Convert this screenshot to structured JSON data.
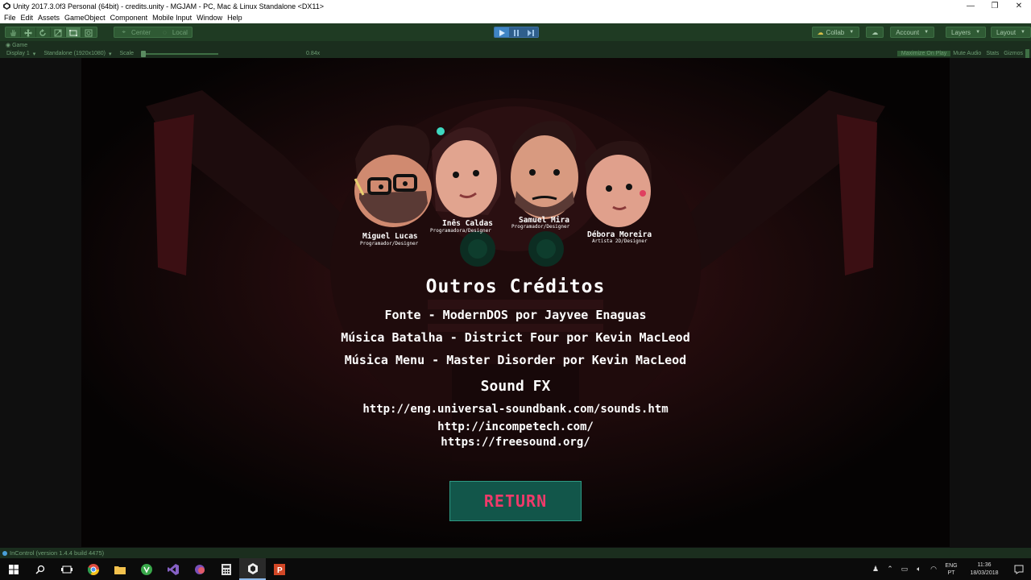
{
  "window": {
    "title": "Unity 2017.3.0f3 Personal (64bit) - credits.unity - MGJAM - PC, Mac & Linux Standalone <DX11>",
    "minimize": "—",
    "maximize": "❐",
    "close": "✕"
  },
  "menu": [
    "File",
    "Edit",
    "Assets",
    "GameObject",
    "Component",
    "Mobile Input",
    "Window",
    "Help"
  ],
  "toolbar": {
    "pivot_center": "Center",
    "pivot_local": "Local",
    "collab": "Collab",
    "account": "Account",
    "layers": "Layers",
    "layout": "Layout"
  },
  "game_view": {
    "tab": "Game",
    "display": "Display 1",
    "resolution": "Standalone (1920x1080)",
    "scale_label": "Scale",
    "scale_value": "0.84x",
    "maximize_on_play": "Maximize On Play",
    "mute_audio": "Mute Audio",
    "stats": "Stats",
    "gizmos": "Gizmos"
  },
  "credits": {
    "team": [
      {
        "name": "Miguel Lucas",
        "role": "Programador/Designer"
      },
      {
        "name": "Inês Caldas",
        "role": "Programadora/Designer"
      },
      {
        "name": "Samuel Mira",
        "role": "Programador/Designer"
      },
      {
        "name": "Débora Moreira",
        "role": "Artista 2D/Designer"
      }
    ],
    "heading": "Outros Créditos",
    "lines": [
      "Fonte - ModernDOS por Jayvee Enaguas",
      "Música Batalha - District Four por Kevin MacLeod",
      "Música Menu - Master Disorder por Kevin MacLeod"
    ],
    "sfx_heading": "Sound FX",
    "urls": [
      "http://eng.universal-soundbank.com/sounds.htm",
      "http://incompetech.com/",
      "https://freesound.org/"
    ],
    "return_button": "RETURN"
  },
  "status": {
    "message": "InControl (version 1.4.4 build 4475)"
  },
  "taskbar": {
    "language": "ENG",
    "region": "PT",
    "time": "11:36",
    "date": "18/03/2018"
  },
  "colors": {
    "toolbar_bg": "#1f3b23",
    "return_bg": "#12564a",
    "return_text": "#f03a6a"
  }
}
